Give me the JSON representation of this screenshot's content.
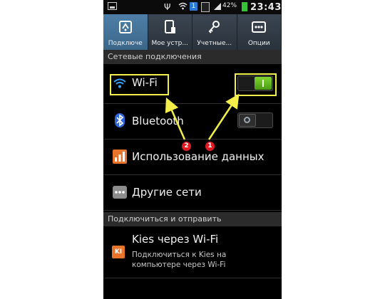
{
  "status_bar": {
    "badge": "1",
    "battery": "42%",
    "time": "23:43"
  },
  "tabs": [
    {
      "label": "Подключе",
      "icon": "connections-icon",
      "active": true
    },
    {
      "label": "Мое устр...",
      "icon": "device-icon",
      "active": false
    },
    {
      "label": "Учетные...",
      "icon": "accounts-key-icon",
      "active": false
    },
    {
      "label": "Опции",
      "icon": "more-options-icon",
      "active": false
    }
  ],
  "sections": {
    "network": "Сетевые подключения",
    "connect_send": "Подключиться и отправить"
  },
  "rows": {
    "wifi": {
      "label": "Wi-Fi",
      "toggle_on": true
    },
    "bluetooth": {
      "label": "Bluetooth",
      "toggle_on": false
    },
    "data_usage": {
      "label": "Использование данных"
    },
    "other_networks": {
      "label": "Другие сети"
    },
    "kies": {
      "label": "Kies через Wi-Fi",
      "sublabel": "Подключиться к Kies на компьютере через Wi-Fi",
      "sub_line1": "Подключиться к Kies на",
      "sub_line2": "компьютере через Wi-Fi",
      "icon_text": "KI"
    }
  },
  "annotations": {
    "marker_1": "1",
    "marker_2": "2",
    "highlight_color": "#f3ee4a",
    "marker_color": "#e01b24"
  },
  "colors": {
    "tab_active": "#4f7fa8",
    "toggle_on": "#6cc524",
    "background": "#000000"
  }
}
